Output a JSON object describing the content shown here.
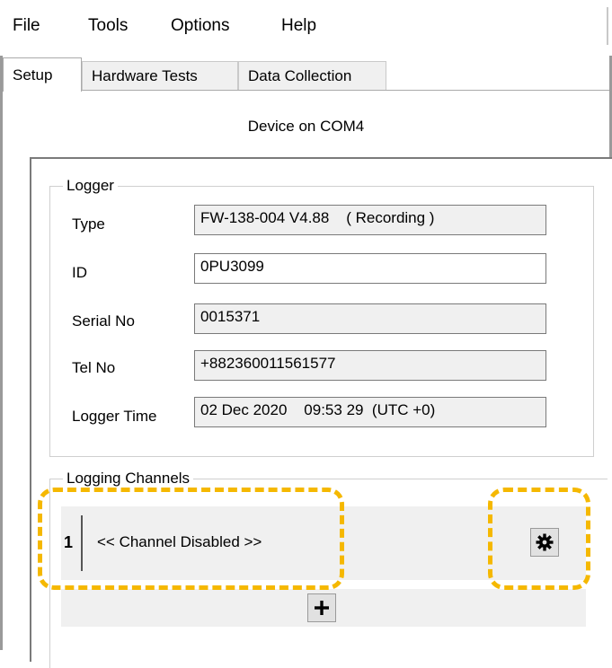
{
  "menu": {
    "file": "File",
    "tools": "Tools",
    "options": "Options",
    "help": "Help"
  },
  "tabs": [
    {
      "label": "Setup",
      "active": true
    },
    {
      "label": "Hardware Tests",
      "active": false
    },
    {
      "label": "Data Collection",
      "active": false
    }
  ],
  "device_label": "Device on COM4",
  "logger": {
    "title": "Logger",
    "type_label": "Type",
    "type_value": "FW-138-004 V4.88    ( Recording )",
    "id_label": "ID",
    "id_value": "0PU3099",
    "serial_label": "Serial No",
    "serial_value": "0015371",
    "tel_label": "Tel No",
    "tel_value": "+882360011561577",
    "time_label": "Logger Time",
    "time_value": "02 Dec 2020    09:53 29  (UTC +0)"
  },
  "channels": {
    "title": "Logging Channels",
    "items": [
      {
        "number": "1",
        "status": "<< Channel Disabled >>"
      }
    ]
  },
  "icons": {
    "settings": "gear-icon",
    "add": "plus-icon"
  },
  "colors": {
    "highlight": "#f5b800"
  }
}
